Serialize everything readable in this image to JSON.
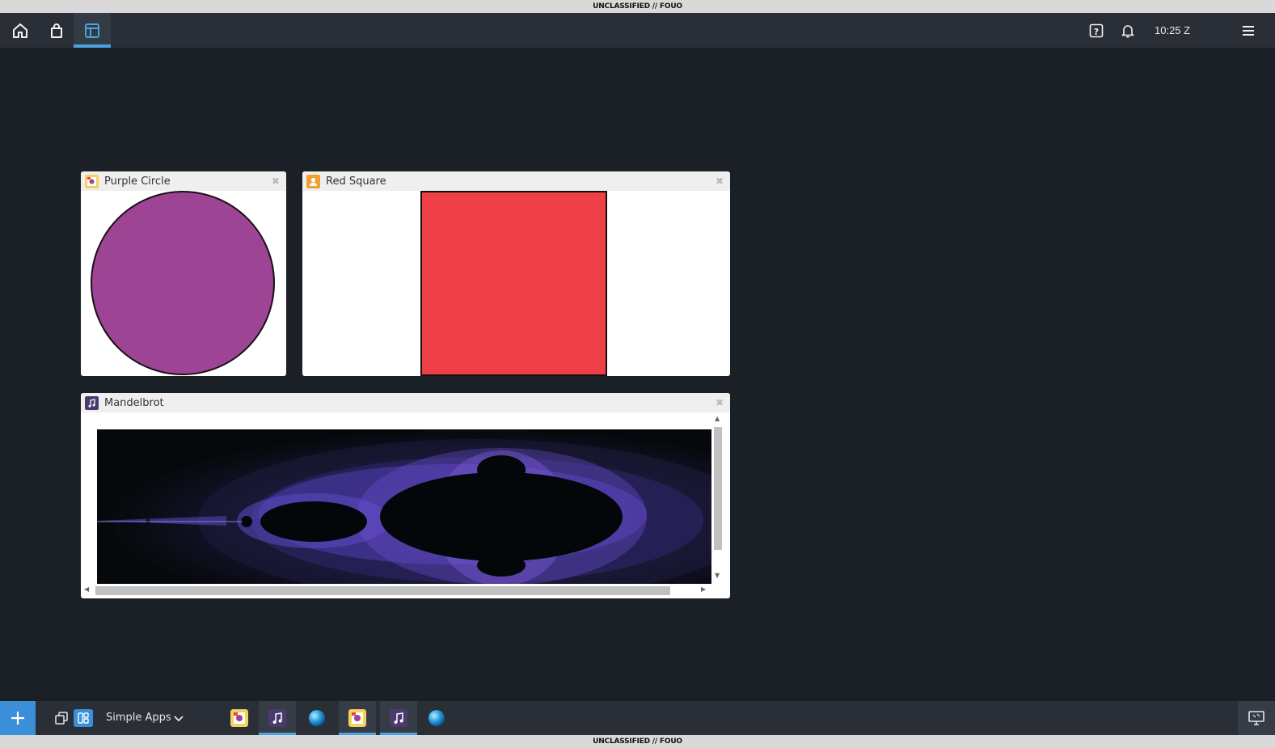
{
  "classification": {
    "top": "UNCLASSIFIED // FOUO",
    "bottom": "UNCLASSIFIED // FOUO"
  },
  "topbar": {
    "buttons": [
      {
        "icon": "home-icon",
        "active": false
      },
      {
        "icon": "app-store-bag-icon",
        "active": false
      },
      {
        "icon": "dashboard-layout-icon",
        "active": true
      }
    ],
    "help_icon": "help-icon",
    "notifications_icon": "bell-icon",
    "clock": "10:25 Z",
    "menu_icon": "hamburger-menu-icon"
  },
  "widgets": {
    "purple_circle": {
      "title": "Purple Circle",
      "icon": "circle-app-icon",
      "fill": "#9e4494"
    },
    "red_square": {
      "title": "Red Square",
      "icon": "square-app-icon",
      "fill": "#ee4046"
    },
    "mandelbrot": {
      "title": "Mandelbrot",
      "icon": "music-note-app-icon"
    }
  },
  "taskbar": {
    "add_icon": "plus-icon",
    "dashboard_name": "Simple Apps",
    "tasks": [
      {
        "app": "Purple Circle",
        "icon": "circle-app-icon",
        "active": false,
        "running": false
      },
      {
        "app": "Mandelbrot",
        "icon": "music-note-app-icon",
        "active": true,
        "running": true
      },
      {
        "app": "Globe",
        "icon": "globe-app-icon",
        "active": false,
        "running": false
      },
      {
        "app": "Purple Circle",
        "icon": "circle-app-icon",
        "active": true,
        "running": true
      },
      {
        "app": "Mandelbrot",
        "icon": "music-note-app-icon",
        "active": true,
        "running": true
      },
      {
        "app": "Globe",
        "icon": "globe-app-icon",
        "active": false,
        "running": false
      }
    ],
    "desktop_icon": "monitor-icon"
  },
  "colors": {
    "accent": "#4aa3df",
    "background": "#1b2027",
    "bar": "#2a2f37"
  }
}
